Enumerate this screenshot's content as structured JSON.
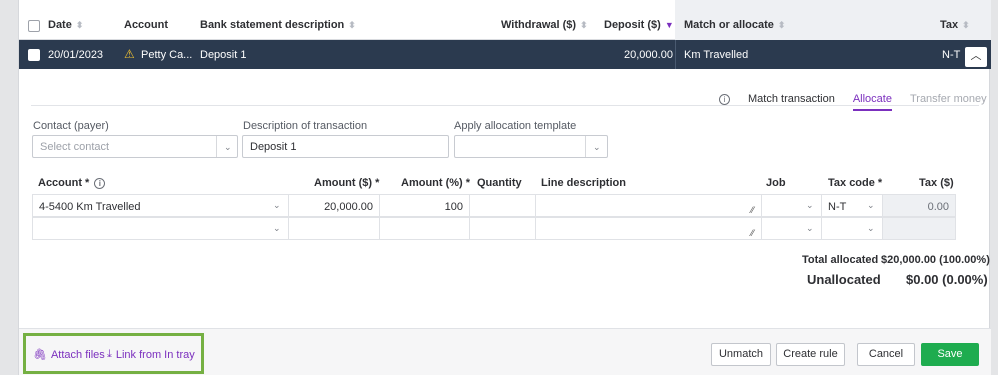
{
  "header": {
    "columns": {
      "date": "Date",
      "account": "Account",
      "bank_desc": "Bank statement description",
      "withdrawal": "Withdrawal ($)",
      "deposit": "Deposit ($)",
      "match": "Match or allocate",
      "tax": "Tax"
    }
  },
  "selected_row": {
    "date": "20/01/2023",
    "account": "Petty Ca...",
    "description": "Deposit 1",
    "deposit": "20,000.00",
    "match": "Km Travelled",
    "tax": "N-T"
  },
  "tabs": {
    "match": "Match transaction",
    "allocate": "Allocate",
    "transfer": "Transfer money"
  },
  "form": {
    "contact_label": "Contact (payer)",
    "contact_placeholder": "Select contact",
    "description_label": "Description of transaction",
    "description_value": "Deposit 1",
    "template_label": "Apply allocation template"
  },
  "alloc_table": {
    "headers": {
      "account": "Account *",
      "amount": "Amount ($) *",
      "percent": "Amount (%) *",
      "quantity": "Quantity",
      "line_desc": "Line description",
      "job": "Job",
      "tax_code": "Tax code *",
      "tax": "Tax ($)"
    },
    "row1": {
      "account": "4-5400  Km Travelled",
      "amount": "20,000.00",
      "percent": "100",
      "tax_code": "N-T",
      "tax": "0.00"
    }
  },
  "totals": {
    "allocated_label": "Total allocated",
    "allocated_value": "$20,000.00 (100.00%)",
    "unallocated_label": "Unallocated",
    "unallocated_value": "$0.00 (0.00%)"
  },
  "footer": {
    "attach": "Attach files",
    "link_tray": "Link from In tray",
    "unmatch": "Unmatch",
    "create_rule": "Create rule",
    "cancel": "Cancel",
    "save": "Save"
  },
  "colors": {
    "accent": "#7b2fbe",
    "save": "#1eac4f",
    "selected_row": "#2b3a4f",
    "highlight": "#75b043"
  }
}
